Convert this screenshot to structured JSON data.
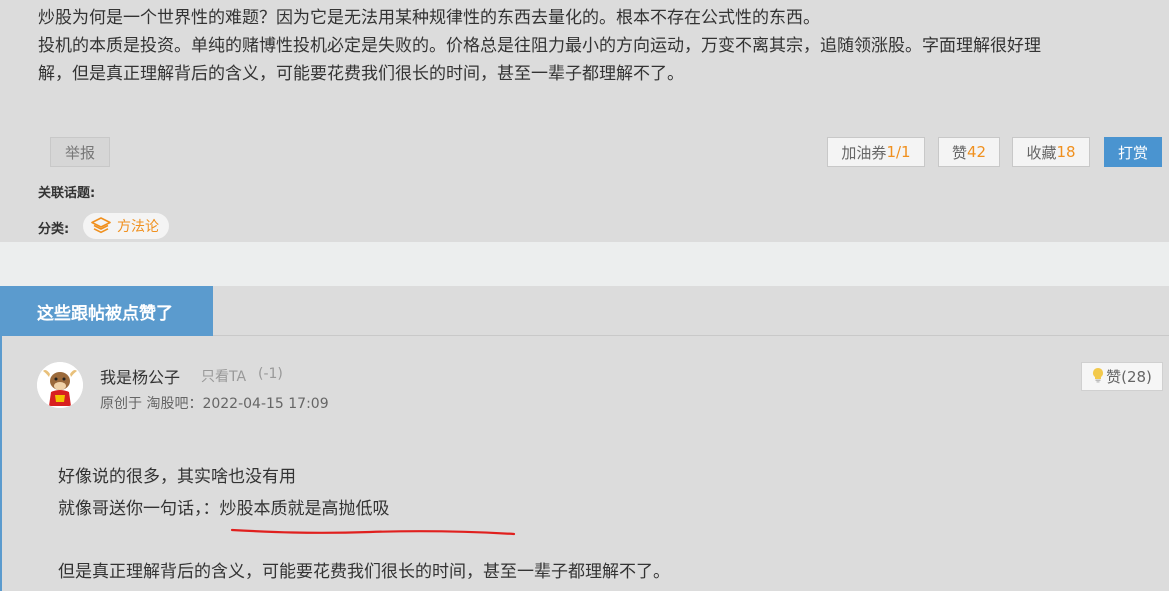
{
  "post": {
    "line1": "炒股为何是一个世界性的难题？因为它是无法用某种规律性的东西去量化的。根本不存在公式性的东西。",
    "line2": "投机的本质是投资。单纯的赌博性投机必定是失败的。价格总是往阻力最小的方向运动，万变不离其宗，追随领涨股。字面理解很好理",
    "line3": "解，但是真正理解背后的含义，可能要花费我们很长的时间，甚至一辈子都理解不了。"
  },
  "actions": {
    "report": "举报",
    "voucher_label": "加油券",
    "voucher_count": "1/1",
    "like_label": "赞",
    "like_count": "42",
    "fav_label": "收藏",
    "fav_count": "18",
    "tip_label": "打赏"
  },
  "meta": {
    "topics_label": "关联话题:",
    "category_label": "分类:",
    "category_value": "方法论"
  },
  "section": {
    "title": "这些跟帖被点赞了"
  },
  "reply": {
    "username": "我是杨公子",
    "only_ta": "只看TA",
    "score": "(-1)",
    "origin": "原创于 淘股吧：2022-04-15 17:09",
    "like_label": "赞(28)",
    "line1": "好像说的很多，其实啥也没有用",
    "line2": "就像哥送你一句话，：炒股本质就是高抛低吸",
    "line3": "但是真正理解背后的含义，可能要花费我们很长的时间，甚至一辈子都理解不了。"
  },
  "colors": {
    "accent_blue": "#5b9bce",
    "orange": "#f0901e",
    "annotation_red": "#e0201e"
  },
  "icons": [
    "layers-icon",
    "lightbulb-icon",
    "avatar-ox-icon"
  ]
}
